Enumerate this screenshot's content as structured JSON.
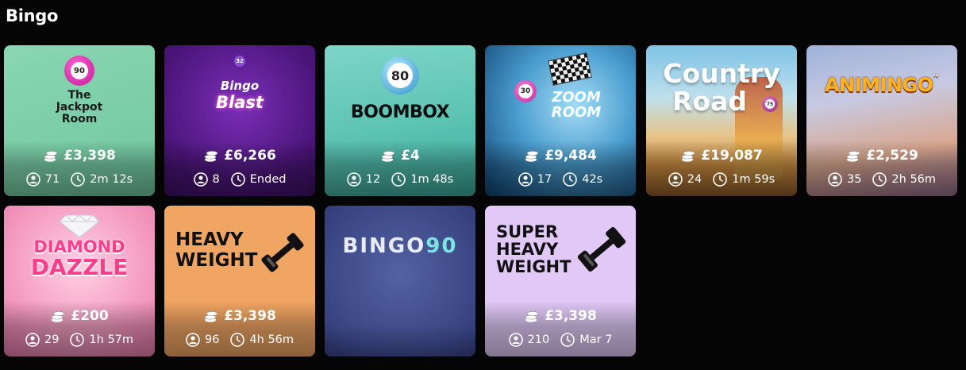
{
  "section": {
    "title": "Bingo"
  },
  "tiles": [
    {
      "name": "The Jackpot Room",
      "logo_line1": "The",
      "logo_line2": "Jackpot",
      "logo_line3": "Room",
      "ball": "90",
      "jackpot": "£3,398",
      "players": "71",
      "time": "2m 12s"
    },
    {
      "name": "Bingo Blast",
      "logo_line1": "Bingo",
      "logo_line2": "Blast",
      "ball": "32",
      "jackpot": "£6,266",
      "players": "8",
      "time": "Ended"
    },
    {
      "name": "Boombox",
      "logo_line1": "BOOMBOX",
      "ball": "80",
      "jackpot": "£4",
      "players": "12",
      "time": "1m 48s"
    },
    {
      "name": "Zoom Room",
      "logo_line1": "ZOOM",
      "logo_line2": "ROOM",
      "ball": "30",
      "jackpot": "£9,484",
      "players": "17",
      "time": "42s"
    },
    {
      "name": "Country Road",
      "logo_line1": "Country",
      "logo_line2": "Road",
      "ball": "75",
      "jackpot": "£19,087",
      "players": "24",
      "time": "1m 59s"
    },
    {
      "name": "Animingo",
      "logo_line1": "ANIMINGO",
      "logo_tm": "™",
      "jackpot": "£2,529",
      "players": "35",
      "time": "2h 56m"
    },
    {
      "name": "Diamond Dazzle",
      "logo_line1": "DIAMOND",
      "logo_line2": "DAZZLE",
      "jackpot": "£200",
      "players": "29",
      "time": "1h 57m"
    },
    {
      "name": "Heavy Weight",
      "logo_line1": "HEAVY",
      "logo_line2": "WEIGHT",
      "jackpot": "£3,398",
      "players": "96",
      "time": "4h 56m"
    },
    {
      "name": "Bingo 90",
      "logo_line1": "BINGO",
      "logo_line2": "90"
    },
    {
      "name": "Super Heavy Weight",
      "logo_line1": "SUPER",
      "logo_line2": "HEAVY",
      "logo_line3": "WEIGHT",
      "jackpot": "£3,398",
      "players": "210",
      "time": "Mar 7"
    }
  ],
  "colors": {
    "page_bg": "#050505",
    "jackpot_room_bg": "#83d2ae",
    "bingo_blast_bg": "#5a1a8e",
    "boombox_bg": "#5fc6b6",
    "zoom_room_bg": "#3b8ec3",
    "country_road_bg": "#d7a25c",
    "animingo_bg": "#b6c0d6",
    "diamond_dazzle_bg": "#f5a3c6",
    "heavy_weight_bg": "#f0a563",
    "bingo90_bg": "#3f4c8c",
    "super_heavy_bg": "#e0c5f5"
  },
  "icons": {
    "jackpot": "coins-icon",
    "players": "user-icon",
    "time": "clock-icon",
    "weight": "dumbbell-icon",
    "flag": "checkered-flag-icon",
    "diamond": "diamond-icon"
  }
}
